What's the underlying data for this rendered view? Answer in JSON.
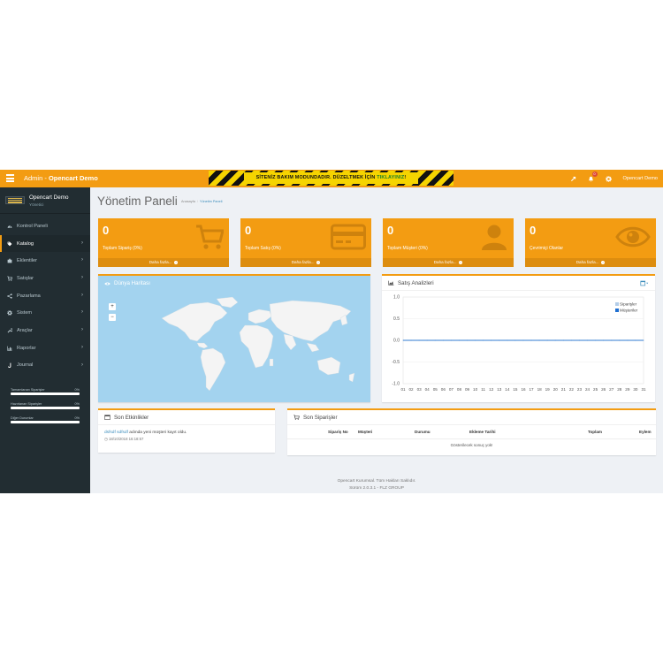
{
  "header": {
    "brand_prefix": "Admin - ",
    "brand_name": "Opencart Demo",
    "maintenance_text": "SİTENİZ BAKIM MODUNDADIR. DÜZELTMEK İÇİN ",
    "maintenance_link": "TIKLAYINIZ",
    "maintenance_suffix": "!",
    "notification_count": "0",
    "user_name": "Opencart Demo"
  },
  "sidebar": {
    "store_name": "Opencart Demo",
    "role": "Yönetici",
    "items": [
      {
        "label": "Kontrol Paneli",
        "icon": "dashboard-icon"
      },
      {
        "label": "Katalog",
        "icon": "tags-icon"
      },
      {
        "label": "Eklentiler",
        "icon": "puzzle-icon"
      },
      {
        "label": "Satışlar",
        "icon": "cart-icon"
      },
      {
        "label": "Pazarlama",
        "icon": "share-icon"
      },
      {
        "label": "Sistem",
        "icon": "cog-icon"
      },
      {
        "label": "Araçlar",
        "icon": "wrench-icon"
      },
      {
        "label": "Raporlar",
        "icon": "bar-chart-icon"
      },
      {
        "label": "Journal",
        "icon": "journal-icon"
      }
    ],
    "progress": [
      {
        "label": "Tamamlanan Siparişler",
        "value": "0%"
      },
      {
        "label": "Hazırlanan Siparişler",
        "value": "0%"
      },
      {
        "label": "Diğer Durumlar",
        "value": "0%"
      }
    ]
  },
  "page": {
    "title": "Yönetim Paneli",
    "breadcrumb": [
      "Anasayfa",
      "Yönetim Paneli"
    ]
  },
  "tiles": [
    {
      "value": "0",
      "label": "Toplam Sipariş (0%)",
      "more": "Daha fazla...",
      "icon": "shopping-cart-icon"
    },
    {
      "value": "0",
      "label": "Toplam Satış (0%)",
      "more": "Daha fazla...",
      "icon": "credit-card-icon"
    },
    {
      "value": "0",
      "label": "Toplam Müşteri (0%)",
      "more": "Daha fazla...",
      "icon": "user-icon"
    },
    {
      "value": "0",
      "label": "Çevrimiçi Olanlar",
      "more": "Daha fazla...",
      "icon": "eye-icon"
    }
  ],
  "map": {
    "title": "Dünya Haritası",
    "zoom_in": "+",
    "zoom_out": "−"
  },
  "sales": {
    "title": "Satış Analizleri"
  },
  "activity": {
    "title": "Son Etkinlikler",
    "entry_link": "dsfsdf sdfsdf",
    "entry_text": " adında yeni müşteri kayıt oldu.",
    "entry_time": "18/10/2018 16:18:57"
  },
  "orders": {
    "title": "Son Siparişler",
    "columns": [
      "Sipariş No",
      "Müşteri",
      "Durumu",
      "Ekleme Tarihi",
      "Toplam",
      "Eylem"
    ],
    "empty": "Gösterilecek sonuç yok!"
  },
  "footer": {
    "line1": "Opencart Kurumsal. Tüm Hakları Saklıdır.",
    "line2": "Sürüm 2.0.3.1 - FLZ GROUP"
  },
  "colors": {
    "accent": "#f39c12",
    "sidebar": "#222d32",
    "map_water": "#a3d3ef",
    "series_orders": "#b3cde8",
    "series_customers": "#1f6fd1"
  },
  "chart_data": {
    "type": "line",
    "x": [
      "01",
      "02",
      "03",
      "04",
      "05",
      "06",
      "07",
      "08",
      "09",
      "10",
      "11",
      "12",
      "13",
      "14",
      "15",
      "16",
      "17",
      "18",
      "19",
      "20",
      "21",
      "22",
      "23",
      "24",
      "25",
      "26",
      "27",
      "28",
      "29",
      "30",
      "31"
    ],
    "series": [
      {
        "name": "Siparişler",
        "values": [
          0,
          0,
          0,
          0,
          0,
          0,
          0,
          0,
          0,
          0,
          0,
          0,
          0,
          0,
          0,
          0,
          0,
          0,
          0,
          0,
          0,
          0,
          0,
          0,
          0,
          0,
          0,
          0,
          0,
          0,
          0
        ]
      },
      {
        "name": "Müşteriler",
        "values": [
          0,
          0,
          0,
          0,
          0,
          0,
          0,
          0,
          0,
          0,
          0,
          0,
          0,
          0,
          0,
          0,
          0,
          0,
          0,
          0,
          0,
          0,
          0,
          0,
          0,
          0,
          0,
          0,
          0,
          0,
          0
        ]
      }
    ],
    "yticks": [
      "1.0",
      "0.5",
      "0.0",
      "-0.5",
      "-1.0"
    ],
    "ylim": [
      -1,
      1
    ],
    "legend": "top-right",
    "grid": true
  }
}
